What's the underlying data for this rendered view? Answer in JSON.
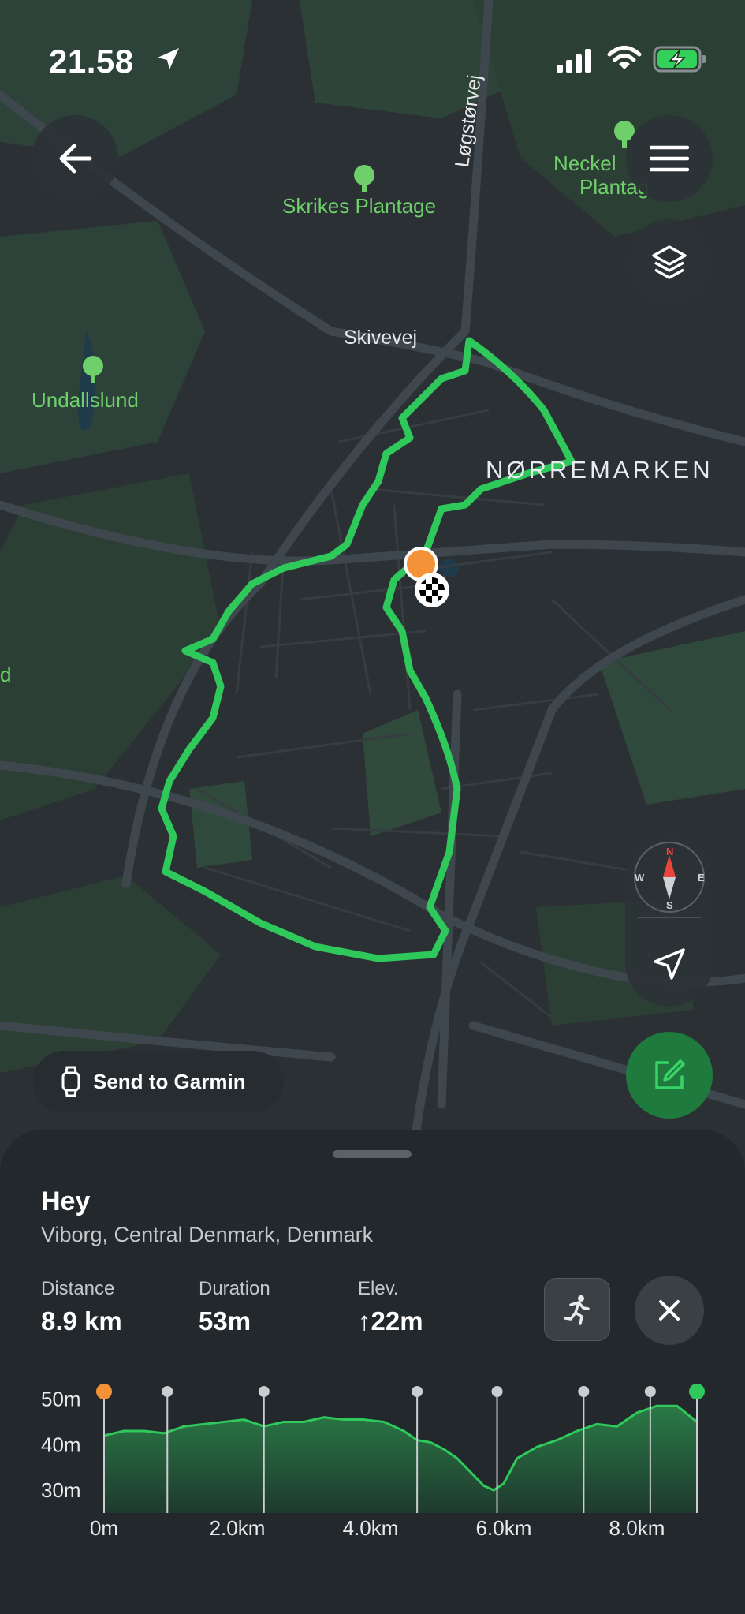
{
  "status_bar": {
    "time": "21.58"
  },
  "map": {
    "labels": {
      "skrikes": "Skrikes Plantage",
      "neckel_1": "Neckel",
      "neckel_2": "Plantag",
      "undallslund": "Undallslund",
      "skivevej": "Skivevej",
      "logstorvej": "Løgstørvej",
      "norremarken": "NØRREMARKEN",
      "edge_d": "d"
    },
    "compass": {
      "n": "N",
      "s": "S",
      "w": "W",
      "e": "E"
    },
    "send_to_garmin": "Send to Garmin",
    "colors": {
      "route": "#2ec95a",
      "start": "#f39237",
      "land": "#2d4238",
      "road": "#3f474e"
    }
  },
  "sheet": {
    "title": "Hey",
    "location": "Viborg, Central Denmark, Denmark",
    "stats": [
      {
        "label": "Distance",
        "value": "8.9 km"
      },
      {
        "label": "Duration",
        "value": "53m"
      },
      {
        "label": "Elev.",
        "value": "↑22m"
      }
    ]
  },
  "chart_data": {
    "type": "area",
    "x_unit": "km",
    "xlim": [
      0,
      8.9
    ],
    "ylim": [
      25,
      52
    ],
    "y_ticks": [
      "50m",
      "40m",
      "30m"
    ],
    "y_tick_values": [
      50,
      40,
      30
    ],
    "x_ticks": [
      "0m",
      "2.0km",
      "4.0km",
      "6.0km",
      "8.0km"
    ],
    "x_tick_values": [
      0,
      2.0,
      4.0,
      6.0,
      8.0
    ],
    "x": [
      0,
      0.3,
      0.6,
      0.9,
      1.2,
      1.5,
      1.8,
      2.1,
      2.4,
      2.7,
      3.0,
      3.3,
      3.6,
      3.9,
      4.2,
      4.5,
      4.7,
      4.9,
      5.1,
      5.3,
      5.5,
      5.7,
      5.85,
      6.0,
      6.2,
      6.5,
      6.8,
      7.1,
      7.4,
      7.7,
      8.0,
      8.3,
      8.6,
      8.9
    ],
    "y": [
      42,
      43,
      43,
      42.5,
      44,
      44.5,
      45,
      45.5,
      44,
      45,
      45,
      46,
      45.5,
      45.5,
      45,
      43,
      41,
      40.5,
      39,
      37,
      34,
      31,
      30,
      31.5,
      37,
      39.5,
      41,
      43,
      44.5,
      44,
      47,
      48.5,
      48.5,
      45
    ],
    "waypoints_km": [
      0,
      0.95,
      2.4,
      4.7,
      5.9,
      7.2,
      8.2,
      8.9
    ],
    "colors": {
      "line": "#2ec95a",
      "fill_top": "#2a7a46",
      "fill_bottom": "#1f3a2e",
      "start": "#f39237",
      "end": "#2ec95a"
    }
  }
}
